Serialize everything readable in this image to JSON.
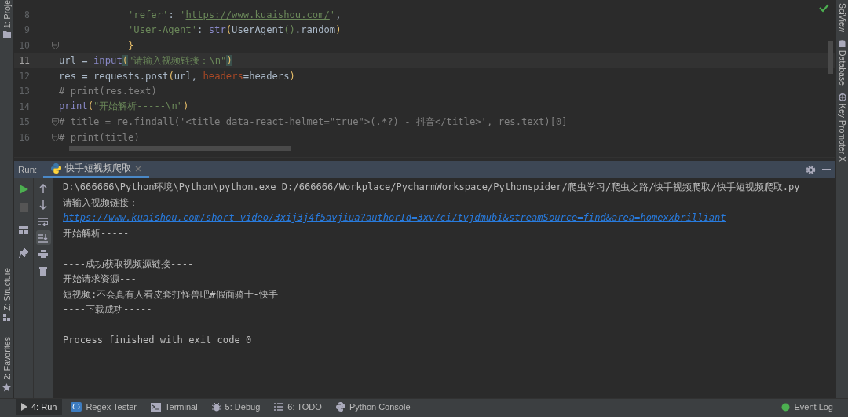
{
  "left_tool_strip": [
    {
      "label": "1: Proje",
      "kind": "project"
    },
    {
      "label": "Z: Structure",
      "kind": "structure"
    },
    {
      "label": "2: Favorites",
      "kind": "favorites"
    }
  ],
  "right_tool_strip": [
    {
      "label": "SciView",
      "kind": "sciview"
    },
    {
      "label": "Database",
      "kind": "database"
    },
    {
      "label": "Key Promoter X",
      "kind": "key"
    }
  ],
  "editor": {
    "lines": [
      {
        "number": "8",
        "fold": false,
        "current": false,
        "indented": true,
        "tokens": [
          {
            "kind": "str",
            "text": "'refer'"
          },
          {
            "kind": "text",
            "text": ": "
          },
          {
            "kind": "str",
            "text": "'"
          },
          {
            "kind": "url",
            "text": "https://www.kuaishou.com/"
          },
          {
            "kind": "str",
            "text": "'"
          },
          {
            "kind": "text",
            "text": ","
          }
        ]
      },
      {
        "number": "9",
        "fold": false,
        "current": false,
        "indented": true,
        "tokens": [
          {
            "kind": "str",
            "text": "'User-Agent'"
          },
          {
            "kind": "text",
            "text": ": "
          },
          {
            "kind": "builtin",
            "text": "str"
          },
          {
            "kind": "bracket",
            "text": "("
          },
          {
            "kind": "text",
            "text": "UserAgent"
          },
          {
            "kind": "paren",
            "text": "()"
          },
          {
            "kind": "text",
            "text": ".random"
          },
          {
            "kind": "bracket",
            "text": ")"
          }
        ]
      },
      {
        "number": "10",
        "fold": true,
        "current": false,
        "indented": true,
        "tokens": [
          {
            "kind": "bracket",
            "text": "}"
          }
        ]
      },
      {
        "number": "11",
        "fold": false,
        "current": true,
        "indented": false,
        "tokens": [
          {
            "kind": "text",
            "text": "url = "
          },
          {
            "kind": "builtin",
            "text": "input"
          },
          {
            "kind": "match",
            "text": "("
          },
          {
            "kind": "str",
            "text": "\"请输入视频链接：\\n\""
          },
          {
            "kind": "match",
            "text": ")"
          }
        ]
      },
      {
        "number": "12",
        "fold": false,
        "current": false,
        "indented": false,
        "tokens": [
          {
            "kind": "text",
            "text": "res = requests.post"
          },
          {
            "kind": "bracket",
            "text": "("
          },
          {
            "kind": "text",
            "text": "url, "
          },
          {
            "kind": "param",
            "text": "headers"
          },
          {
            "kind": "text",
            "text": "=headers"
          },
          {
            "kind": "bracket",
            "text": ")"
          }
        ]
      },
      {
        "number": "13",
        "fold": false,
        "current": false,
        "indented": false,
        "tokens": [
          {
            "kind": "comment",
            "text": "# print(res.text)"
          }
        ]
      },
      {
        "number": "14",
        "fold": false,
        "current": false,
        "indented": false,
        "tokens": [
          {
            "kind": "builtin",
            "text": "print"
          },
          {
            "kind": "bracket",
            "text": "("
          },
          {
            "kind": "str",
            "text": "\"开始解析-----\\n\""
          },
          {
            "kind": "bracket",
            "text": ")"
          }
        ]
      },
      {
        "number": "15",
        "fold": true,
        "current": false,
        "indented": false,
        "tokens": [
          {
            "kind": "comment",
            "text": "# title = re.findall('<title data-react-helmet=\"true\">(.*?) - 抖音</title>', res.text)[0]"
          }
        ]
      },
      {
        "number": "16",
        "fold": true,
        "current": false,
        "indented": false,
        "tokens": [
          {
            "kind": "comment",
            "text": "# print(title)"
          }
        ]
      }
    ]
  },
  "run_panel": {
    "label": "Run:",
    "tab": {
      "title": "快手短视频爬取",
      "selected": true
    },
    "tools_left": [
      {
        "kind": "run"
      },
      {
        "kind": "stop"
      },
      {
        "kind": "layout"
      },
      {
        "kind": "pin"
      }
    ],
    "tools_right": [
      {
        "kind": "up",
        "selected": false
      },
      {
        "kind": "down",
        "selected": false
      },
      {
        "kind": "wrap",
        "selected": false
      },
      {
        "kind": "scroll-end",
        "selected": true
      },
      {
        "kind": "print",
        "selected": false
      },
      {
        "kind": "trash",
        "selected": false
      }
    ],
    "console": [
      {
        "kind": "text",
        "text": "D:\\666666\\Python环境\\Python\\python.exe D:/666666/Workplace/PycharmWorkspace/Pythonspider/爬虫学习/爬虫之路/快手视频爬取/快手短视频爬取.py"
      },
      {
        "kind": "text",
        "text": "请输入视频链接："
      },
      {
        "kind": "link",
        "text": "https://www.kuaishou.com/short-video/3xij3j4f5avjiua?authorId=3xv7ci7tvjdmubi&streamSource=find&area=homexxbrilliant"
      },
      {
        "kind": "text",
        "text": "开始解析-----"
      },
      {
        "kind": "blank"
      },
      {
        "kind": "text",
        "text": "----成功获取视频源链接----"
      },
      {
        "kind": "text",
        "text": "开始请求资源---"
      },
      {
        "kind": "text",
        "text": "短视频:不会真有人看皮套打怪兽吧#假面骑士-快手"
      },
      {
        "kind": "text",
        "text": "----下载成功-----"
      },
      {
        "kind": "blank"
      },
      {
        "kind": "text",
        "text": "Process finished with exit code 0"
      }
    ]
  },
  "bottom_tabs": [
    {
      "label": "4: Run",
      "kind": "run",
      "selected": true
    },
    {
      "label": "Regex Tester",
      "kind": "regex",
      "selected": false
    },
    {
      "label": "Terminal",
      "kind": "terminal",
      "selected": false
    },
    {
      "label": "5: Debug",
      "kind": "debug",
      "selected": false
    },
    {
      "label": "6: TODO",
      "kind": "todo",
      "selected": false
    },
    {
      "label": "Python Console",
      "kind": "python",
      "selected": false
    },
    {
      "label": "Event Log",
      "kind": "event",
      "selected": false
    }
  ]
}
